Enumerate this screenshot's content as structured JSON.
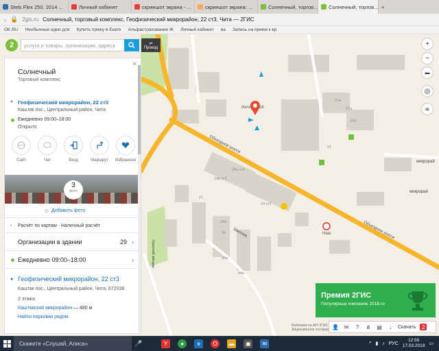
{
  "browser": {
    "tabs": [
      {
        "label": "Stels Flex 250. 2014 ...",
        "color": "#2b6cb0"
      },
      {
        "label": "Личный кабинет",
        "color": "#e53e3e"
      },
      {
        "label": "скриншот экрана - ...",
        "color": "#e53e3e"
      },
      {
        "label": "скриншот экрана: ...",
        "color": "#f6ad55"
      },
      {
        "label": "Солнечный, торгов...",
        "color": "#7bbf3a"
      },
      {
        "label": "Солнечный, торгов...",
        "color": "#7bbf3a"
      }
    ],
    "new_tab": "+",
    "address_domain": "2gis.ru",
    "address_title": "Солнечный, торговый комплекс, Геофизический микрорайон, 22 ст3, Чита — 2ГИС",
    "bookmarks": [
      "OK.RU",
      "Необычные идеи для",
      "Купить пряжу в Екате",
      "Альфастрахование Ж",
      "Личный кабинет",
      "ва",
      "Запись на прием к вр"
    ]
  },
  "search": {
    "logo": "2",
    "placeholder": "услуги и товары, организации, адреса",
    "route_label": "Проезд"
  },
  "card": {
    "name": "Солнечный",
    "category": "Торговый комплекс",
    "address": "Геофизический микрорайон, 22 ст3",
    "district": "Каштак пос., Центральный район, Чита",
    "hours": "Ежедневно 09:00–18:00",
    "status": "Открыто",
    "actions": [
      {
        "label": "Сайт",
        "icon": "globe-icon"
      },
      {
        "label": "Чат",
        "icon": "chat-icon"
      },
      {
        "label": "Вход",
        "icon": "entrance-icon"
      },
      {
        "label": "Маршрут",
        "icon": "route-icon"
      },
      {
        "label": "Избранное",
        "icon": "heart-icon"
      }
    ],
    "photos_count": "3",
    "photos_label": "фото",
    "add_photo": "Добавить фото",
    "payment": "Расчёт по картам · Наличный расчёт",
    "orgs_label": "Организации в здании",
    "orgs_count": "29",
    "daily_hours": "Ежедневно 09:00–18:00",
    "full_address": "Геофизический микрорайон, 22 ст3",
    "full_address_sub": "Каштак пос., Центральный район, Чита, 672038",
    "floors": "2 этажа",
    "metro_link": "Каштакский микрорайон",
    "metro_distance": " — 480 м",
    "parking": "Найти парковки рядом"
  },
  "map": {
    "labels": {
      "obkhod_1": "Объездное шоссе",
      "obkhod_2": "Объездное шоссе",
      "shilova": "Шилова",
      "krasnoy": "Красной звезды",
      "mikrora_1": "микрорай",
      "mikrora_2": "микрорай",
      "interstroy": "Интерстрой",
      "nash": "Наш",
      "b1": "21в",
      "b2": "21а",
      "b3": "21б",
      "b4": "21",
      "b5": "24а ст1",
      "b6": "24в ст1",
      "b7": "24 ст1",
      "b8": "27",
      "b9": "26а",
      "b10": "26",
      "b11": "44а",
      "b12": "44в"
    },
    "road_color": "#f7b52b",
    "building_color": "#d9d4c9",
    "green_color": "#c9e3a7"
  },
  "controls": [
    "plus-icon",
    "minus-icon",
    "ruler-icon",
    "locate-icon",
    "layers-icon"
  ],
  "promo": {
    "title": "Премия 2ГИС",
    "subtitle": "Популярные компании 2018-го"
  },
  "map_toolbar": {
    "download": "Скачать",
    "notif": "2"
  },
  "map_copyright": [
    "Работаем на API 2ГИС",
    "Лицензионное соглашение"
  ],
  "taskbar": {
    "search": "Скажите «Слушай, Алиса»",
    "lang": "РУС",
    "time": "12:55",
    "date": "17.03.2019"
  }
}
